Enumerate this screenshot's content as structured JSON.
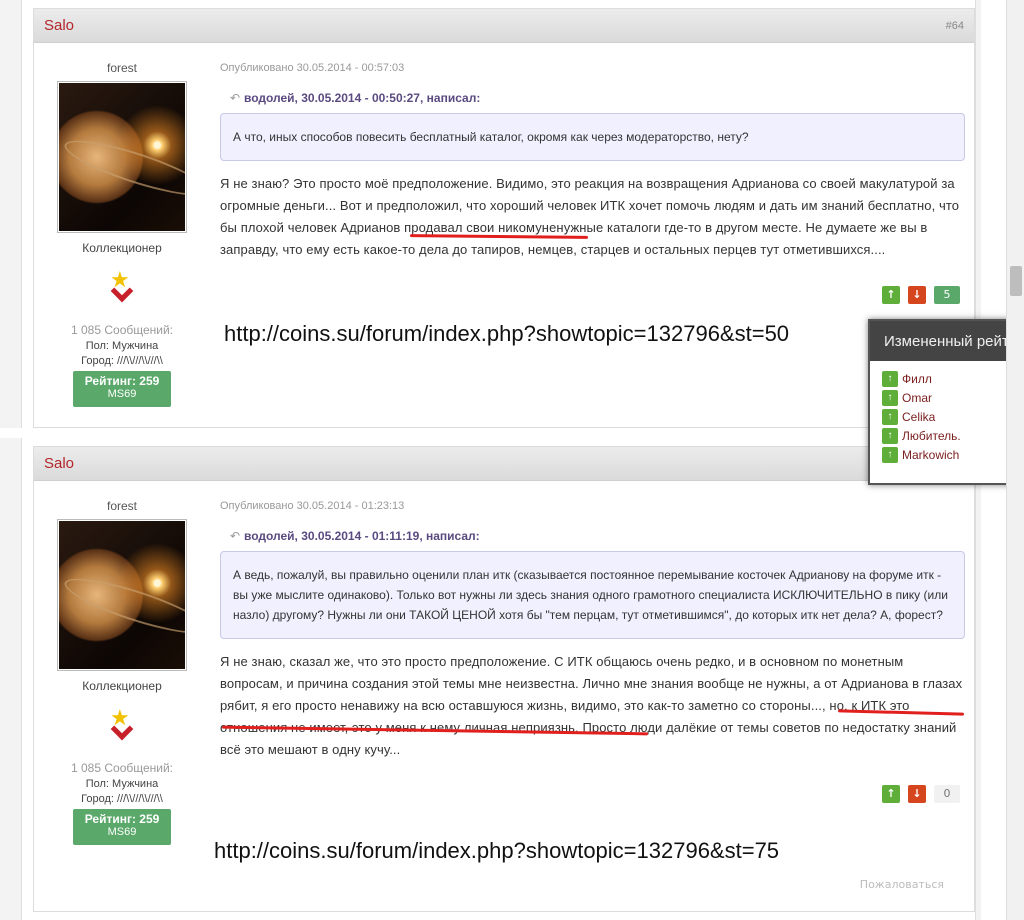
{
  "posts": [
    {
      "author": "Salo",
      "number": "#64",
      "user_name": "forest",
      "user_title": "Коллекционер",
      "message_count": "1 085 Сообщений:",
      "gender_label": "Пол: Мужчина",
      "city_label": "Город: ///\\\\///\\\\///\\\\",
      "rating": "Рейтинг: 259",
      "rating_sub": "MS69",
      "posted": "Опубликовано 30.05.2014 - 00:57:03",
      "quote_citation": "водолей, 30.05.2014 - 00:50:27, написал:",
      "quote_text": "А что, иных способов повесить бесплатный каталог, окромя как через модераторство, нету?",
      "body": "Я не знаю? Это просто моё предположение. Видимо, это реакция на возвращения Адрианова со своей макулатурой за огромные деньги... Вот и предположил, что хороший человек ИТК хочет помочь людям и дать им знаний бесплатно, что бы плохой человек Адрианов продавал свои никомуненужные каталоги где-то в другом месте. Не думаете же вы в заправду, что ему есть какое-то дела до тапиров, немцев, старцев и остальных перцев тут отметившихся....",
      "vote_count": "5",
      "overlay_url": "http://coins.su/forum/index.php?showtopic=132796&st=50"
    },
    {
      "author": "Salo",
      "user_name": "forest",
      "user_title": "Коллекционер",
      "message_count": "1 085 Сообщений:",
      "gender_label": "Пол: Мужчина",
      "city_label": "Город: ///\\\\///\\\\///\\\\",
      "rating": "Рейтинг: 259",
      "rating_sub": "MS69",
      "posted": "Опубликовано 30.05.2014 - 01:23:13",
      "quote_citation": "водолей, 30.05.2014 - 01:11:19, написал:",
      "quote_text": "А ведь, пожалуй, вы правильно оценили план итк (сказывается постоянное перемывание косточек Адрианову на форуме итк - вы уже мыслите одинаково). Только вот нужны ли здесь знания одного грамотного специалиста ИСКЛЮЧИТЕЛЬНО в пику (или назло) другому? Нужны ли они ТАКОЙ ЦЕНОЙ хотя бы \"тем перцам, тут отметившимся\", до которых итк нет дела? А, форест?",
      "body": "Я не знаю, сказал же, что это просто предположение. С ИТК общаюсь очень редко, и в основном по монетным вопросам, и причина создания этой темы мне неизвестна. Лично мне знания вообще не нужны, а от Адрианова в глазах рябит, я его просто ненавижу на всю оставшуюся жизнь, видимо, это как-то заметно со стороны..., но, к ИТК это отношения не имеет, это у меня к нему личная неприязнь. Просто люди далёкие от темы советов по недостатку знаний всё это мешают в одну кучу...",
      "vote_count": "0",
      "overlay_url": "http://coins.su/forum/index.php?showtopic=132796&st=75",
      "report": "Пожаловаться"
    }
  ],
  "rating_popup": {
    "title": "Измененный рейтинг",
    "users": [
      "Филл",
      "Omar",
      "Celika",
      "Любитель.",
      "Markowich"
    ]
  },
  "colors": {
    "author": "#b3262a",
    "up": "#5fae3a",
    "down": "#d5461f",
    "rating": "#5aa86a",
    "underline": "#e1201e"
  }
}
